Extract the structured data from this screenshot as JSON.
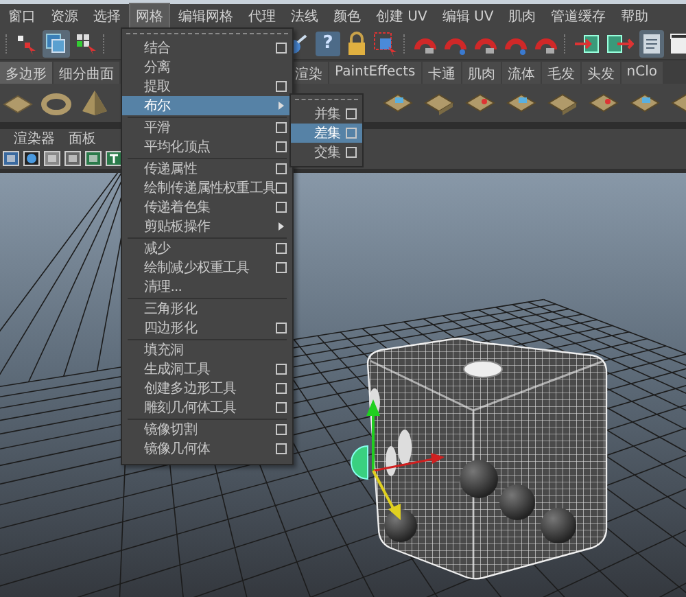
{
  "menubar": [
    {
      "label": "窗口",
      "selected": false
    },
    {
      "label": "资源",
      "selected": false
    },
    {
      "label": "选择",
      "selected": false
    },
    {
      "label": "网格",
      "selected": true
    },
    {
      "label": "编辑网格",
      "selected": false
    },
    {
      "label": "代理",
      "selected": false
    },
    {
      "label": "法线",
      "selected": false
    },
    {
      "label": "颜色",
      "selected": false
    },
    {
      "label": "创建 UV",
      "selected": false
    },
    {
      "label": "编辑 UV",
      "selected": false
    },
    {
      "label": "肌肉",
      "selected": false
    },
    {
      "label": "管道缓存",
      "selected": false
    },
    {
      "label": "帮助",
      "selected": false
    }
  ],
  "toolbar": {
    "help_label": "?"
  },
  "shelf_tabs": [
    {
      "label": "多边形",
      "selected": true
    },
    {
      "label": "细分曲面",
      "selected": false
    },
    {
      "label": "渲染",
      "selected": false
    },
    {
      "label": "PaintEffects",
      "selected": false
    },
    {
      "label": "卡通",
      "selected": false
    },
    {
      "label": "肌肉",
      "selected": false
    },
    {
      "label": "流体",
      "selected": false
    },
    {
      "label": "毛发",
      "selected": false
    },
    {
      "label": "头发",
      "selected": false
    },
    {
      "label": "nClo",
      "selected": false
    }
  ],
  "panel_menu": [
    "渲染器",
    "面板"
  ],
  "menu": {
    "groups": [
      [
        {
          "label": "结合",
          "option_box": true,
          "submenu": false,
          "selected": false
        },
        {
          "label": "分离",
          "option_box": false,
          "submenu": false,
          "selected": false
        },
        {
          "label": "提取",
          "option_box": true,
          "submenu": false,
          "selected": false
        },
        {
          "label": "布尔",
          "option_box": false,
          "submenu": true,
          "selected": true
        }
      ],
      [
        {
          "label": "平滑",
          "option_box": true,
          "submenu": false,
          "selected": false
        },
        {
          "label": "平均化顶点",
          "option_box": true,
          "submenu": false,
          "selected": false
        }
      ],
      [
        {
          "label": "传递属性",
          "option_box": true,
          "submenu": false,
          "selected": false
        },
        {
          "label": "绘制传递属性权重工具",
          "option_box": true,
          "submenu": false,
          "selected": false
        },
        {
          "label": "传递着色集",
          "option_box": true,
          "submenu": false,
          "selected": false
        },
        {
          "label": "剪贴板操作",
          "option_box": false,
          "submenu": true,
          "selected": false
        }
      ],
      [
        {
          "label": "减少",
          "option_box": true,
          "submenu": false,
          "selected": false
        },
        {
          "label": "绘制减少权重工具",
          "option_box": true,
          "submenu": false,
          "selected": false
        },
        {
          "label": "清理...",
          "option_box": false,
          "submenu": false,
          "selected": false
        }
      ],
      [
        {
          "label": "三角形化",
          "option_box": false,
          "submenu": false,
          "selected": false
        },
        {
          "label": "四边形化",
          "option_box": true,
          "submenu": false,
          "selected": false
        }
      ],
      [
        {
          "label": "填充洞",
          "option_box": false,
          "submenu": false,
          "selected": false
        },
        {
          "label": "生成洞工具",
          "option_box": true,
          "submenu": false,
          "selected": false
        },
        {
          "label": "创建多边形工具",
          "option_box": true,
          "submenu": false,
          "selected": false
        },
        {
          "label": "雕刻几何体工具",
          "option_box": true,
          "submenu": false,
          "selected": false
        }
      ],
      [
        {
          "label": "镜像切割",
          "option_box": true,
          "submenu": false,
          "selected": false
        },
        {
          "label": "镜像几何体",
          "option_box": true,
          "submenu": false,
          "selected": false
        }
      ]
    ]
  },
  "submenu": [
    {
      "label": "并集",
      "option_box": true,
      "selected": false
    },
    {
      "label": "差集",
      "option_box": true,
      "selected": true
    },
    {
      "label": "交集",
      "option_box": true,
      "selected": false
    }
  ]
}
